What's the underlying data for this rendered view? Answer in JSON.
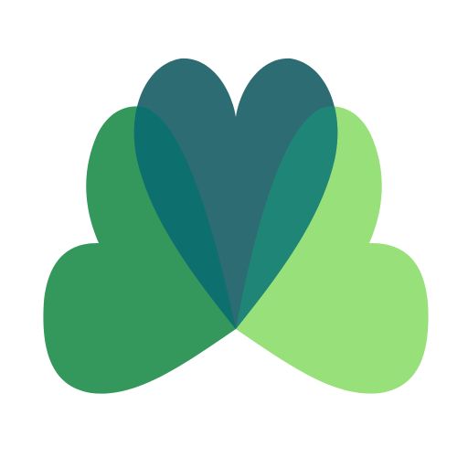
{
  "logo": {
    "icon": "three-hearts-clover-icon",
    "colors": {
      "background": "#ffffff",
      "left_heart": "#34975c",
      "right_heart": "#97e07a",
      "top_heart": "#2d6c72",
      "left_overlap": "#0d6f6e",
      "right_overlap": "#1f8577"
    }
  }
}
